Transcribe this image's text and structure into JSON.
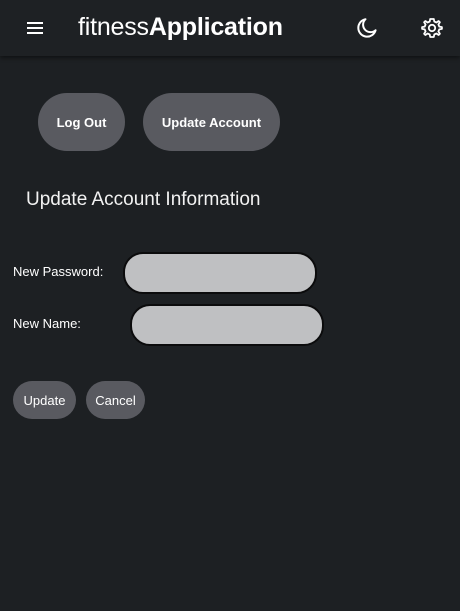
{
  "header": {
    "title_light": "fitness",
    "title_bold": "Application",
    "menu_icon": "hamburger-menu-icon",
    "theme_icon": "moon-icon",
    "settings_icon": "gear-icon"
  },
  "account_nav": {
    "logout_label": "Log Out",
    "update_account_label": "Update Account"
  },
  "form": {
    "title": "Update Account Information",
    "password_label": "New Password:",
    "password_value": "",
    "name_label": "New Name:",
    "name_value": "",
    "update_label": "Update",
    "cancel_label": "Cancel"
  },
  "colors": {
    "background": "#1d2023",
    "button": "#595a60",
    "input": "#bfc0c2"
  }
}
